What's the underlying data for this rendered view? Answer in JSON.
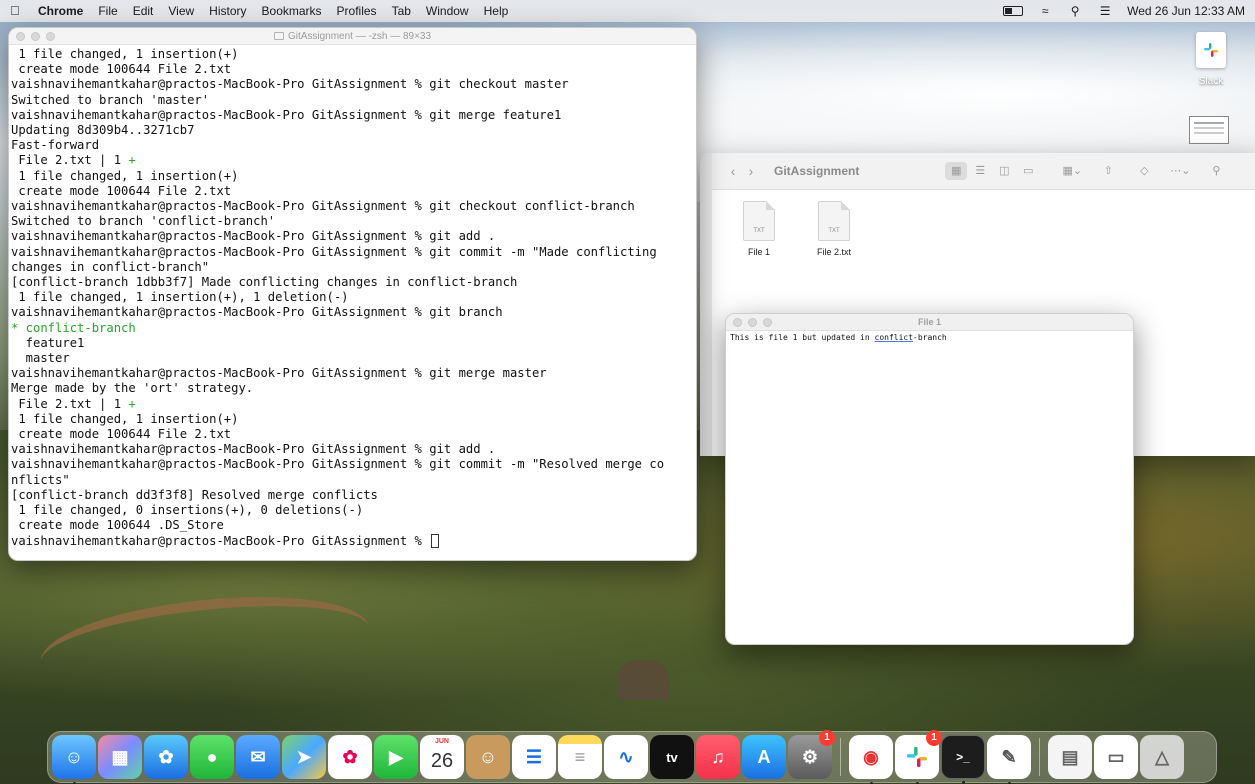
{
  "menubar": {
    "app_name": "Chrome",
    "menus": [
      "File",
      "Edit",
      "View",
      "History",
      "Bookmarks",
      "Profiles",
      "Tab",
      "Window",
      "Help"
    ],
    "clock": "Wed 26 Jun  12:33 AM"
  },
  "desktop": {
    "slack_label": "Slack"
  },
  "terminal": {
    "title": "GitAssignment — -zsh — 89×33",
    "lines": [
      {
        "text": " 1 file changed, 1 insertion(+)"
      },
      {
        "text": " create mode 100644 File 2.txt"
      },
      {
        "text": "vaishnavihemantkahar@practos-MacBook-Pro GitAssignment % git checkout master"
      },
      {
        "text": "Switched to branch 'master'"
      },
      {
        "text": "vaishnavihemantkahar@practos-MacBook-Pro GitAssignment % git merge feature1"
      },
      {
        "text": "Updating 8d309b4..3271cb7"
      },
      {
        "text": "Fast-forward"
      },
      {
        "text": " File 2.txt | 1 ",
        "plus": "+"
      },
      {
        "text": " 1 file changed, 1 insertion(+)"
      },
      {
        "text": " create mode 100644 File 2.txt"
      },
      {
        "text": "vaishnavihemantkahar@practos-MacBook-Pro GitAssignment % git checkout conflict-branch"
      },
      {
        "text": "Switched to branch 'conflict-branch'"
      },
      {
        "text": "vaishnavihemantkahar@practos-MacBook-Pro GitAssignment % git add ."
      },
      {
        "text": "vaishnavihemantkahar@practos-MacBook-Pro GitAssignment % git commit -m \"Made conflicting"
      },
      {
        "text": "changes in conflict-branch\""
      },
      {
        "text": "[conflict-branch 1dbb3f7] Made conflicting changes in conflict-branch"
      },
      {
        "text": " 1 file changed, 1 insertion(+), 1 deletion(-)"
      },
      {
        "text": "vaishnavihemantkahar@practos-MacBook-Pro GitAssignment % git branch"
      },
      {
        "text": "* conflict-branch",
        "green": true
      },
      {
        "text": "  feature1"
      },
      {
        "text": "  master"
      },
      {
        "text": "vaishnavihemantkahar@practos-MacBook-Pro GitAssignment % git merge master"
      },
      {
        "text": "Merge made by the 'ort' strategy."
      },
      {
        "text": " File 2.txt | 1 ",
        "plus": "+"
      },
      {
        "text": " 1 file changed, 1 insertion(+)"
      },
      {
        "text": " create mode 100644 File 2.txt"
      },
      {
        "text": "vaishnavihemantkahar@practos-MacBook-Pro GitAssignment % git add ."
      },
      {
        "text": "vaishnavihemantkahar@practos-MacBook-Pro GitAssignment % git commit -m \"Resolved merge co"
      },
      {
        "text": "nflicts\""
      },
      {
        "text": "[conflict-branch dd3f3f8] Resolved merge conflicts"
      },
      {
        "text": " 1 file changed, 0 insertions(+), 0 deletions(-)"
      },
      {
        "text": " create mode 100644 .DS_Store"
      },
      {
        "text": "vaishnavihemantkahar@practos-MacBook-Pro GitAssignment % ",
        "cursor": true
      }
    ]
  },
  "finder": {
    "title": "GitAssignment",
    "files": [
      {
        "name": "File 1",
        "type": "TXT"
      },
      {
        "name": "File 2.txt",
        "type": "TXT"
      }
    ]
  },
  "textedit": {
    "title": "File 1",
    "content_before": "This is file 1 but updated in ",
    "content_underlined": "conflict",
    "content_after": "-branch"
  },
  "dock": {
    "calendar_month": "JUN",
    "calendar_day": "26",
    "settings_badge": "1",
    "slack_badge": "1",
    "tv_label": "tv"
  },
  "colors": {
    "terminal_green": "#2aa52a",
    "badge_red": "#ff3b30"
  }
}
